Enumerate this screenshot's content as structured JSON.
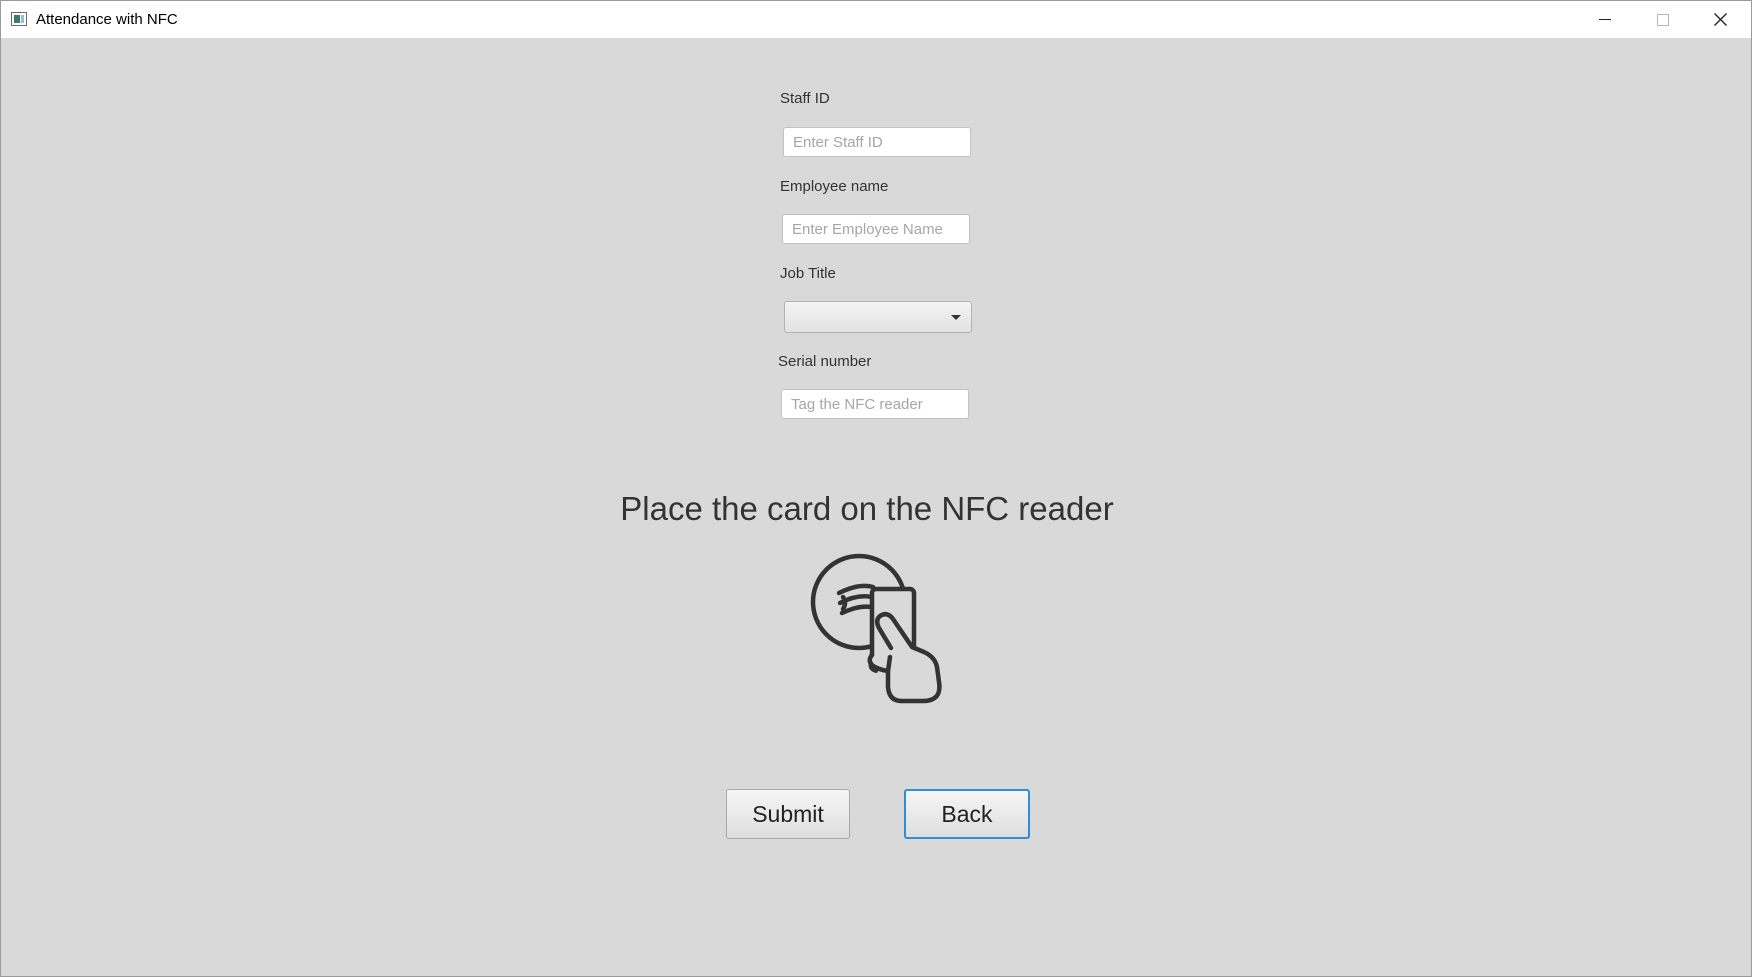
{
  "window": {
    "title": "Attendance with NFC"
  },
  "form": {
    "staff_id": {
      "label": "Staff ID",
      "value": "",
      "placeholder": "Enter Staff ID"
    },
    "employee_name": {
      "label": "Employee name",
      "value": "",
      "placeholder": "Enter Employee Name"
    },
    "job_title": {
      "label": "Job Title",
      "selected": ""
    },
    "serial_number": {
      "label": "Serial number",
      "value": "",
      "placeholder": "Tag the NFC reader"
    }
  },
  "instruction": {
    "text": "Place the card on the NFC reader",
    "icon": "hand-holding-card-on-nfc-reader-icon"
  },
  "buttons": {
    "submit_label": "Submit",
    "back_label": "Back"
  },
  "colors": {
    "background": "#d9d9d9",
    "focus_border": "#2f8fd4",
    "text": "#333333"
  }
}
